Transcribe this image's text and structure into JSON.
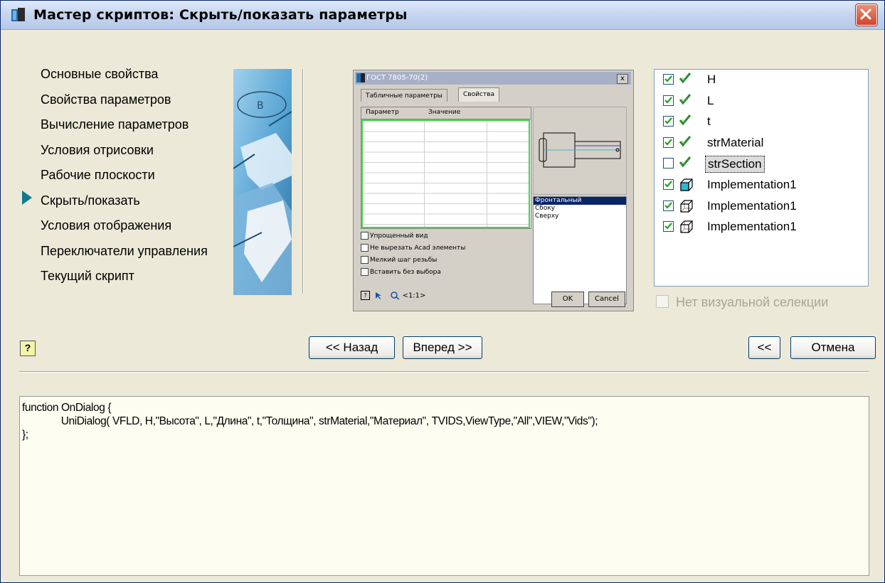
{
  "window": {
    "title": "Мастер скриптов:  Скрыть/показать параметры"
  },
  "steps": [
    {
      "label": "Основные свойства"
    },
    {
      "label": "Свойства параметров"
    },
    {
      "label": "Вычисление параметров"
    },
    {
      "label": "Условия отрисовки"
    },
    {
      "label": "Рабочие плоскости"
    },
    {
      "label": "Скрыть/показать",
      "current": true
    },
    {
      "label": "Условия отображения"
    },
    {
      "label": "Переключатели управления"
    },
    {
      "label": "Текущий скрипт"
    }
  ],
  "preview": {
    "title": "ГОСТ 7805-70(2)",
    "close": "x",
    "tabs": [
      "Табличные параметры",
      "Свойства"
    ],
    "columns": [
      "Параметр",
      "Значение"
    ],
    "views": [
      "Фронтальный",
      "Сбоку",
      "Сверху"
    ],
    "checks": [
      "Упрощенный вид",
      "Не вырезать Acad элементы",
      "Мелкий шаг резьбы",
      "Вставить без выбора"
    ],
    "scale": "<1:1>",
    "ok": "OK",
    "cancel": "Cancel"
  },
  "params": [
    {
      "label": "H",
      "checked": true,
      "icon": "check-mark-icon"
    },
    {
      "label": "L",
      "checked": true,
      "icon": "check-mark-icon"
    },
    {
      "label": "t",
      "checked": true,
      "icon": "check-mark-icon"
    },
    {
      "label": "strMaterial",
      "checked": true,
      "icon": "check-mark-icon"
    },
    {
      "label": "strSection",
      "checked": false,
      "icon": "check-mark-icon",
      "selected": true
    },
    {
      "label": "Implementation1",
      "checked": true,
      "icon": "cube-solid-icon"
    },
    {
      "label": "Implementation1",
      "checked": true,
      "icon": "cube-wire-icon"
    },
    {
      "label": "Implementation1",
      "checked": true,
      "icon": "cube-wire-icon"
    }
  ],
  "no_visual_selection": {
    "label": "Нет визуальной селекции",
    "checked": false,
    "enabled": false
  },
  "buttons": {
    "help": "?",
    "back": "<< Назад",
    "next": "Вперед >>",
    "collapse": "<<",
    "cancel": "Отмена"
  },
  "script": {
    "lines": [
      "function OnDialog {",
      "              UniDialog( VFLD, H,\"Высота\", L,\"Длина\", t,\"Толщина\", strMaterial,\"Материал\", TVIDS,ViewType,\"All\",VIEW,\"Vids\");",
      "};"
    ]
  },
  "colors": {
    "accent": "#117a8b",
    "check": "#2e8b2e",
    "title_gradient_end": "#b6c8ea"
  }
}
